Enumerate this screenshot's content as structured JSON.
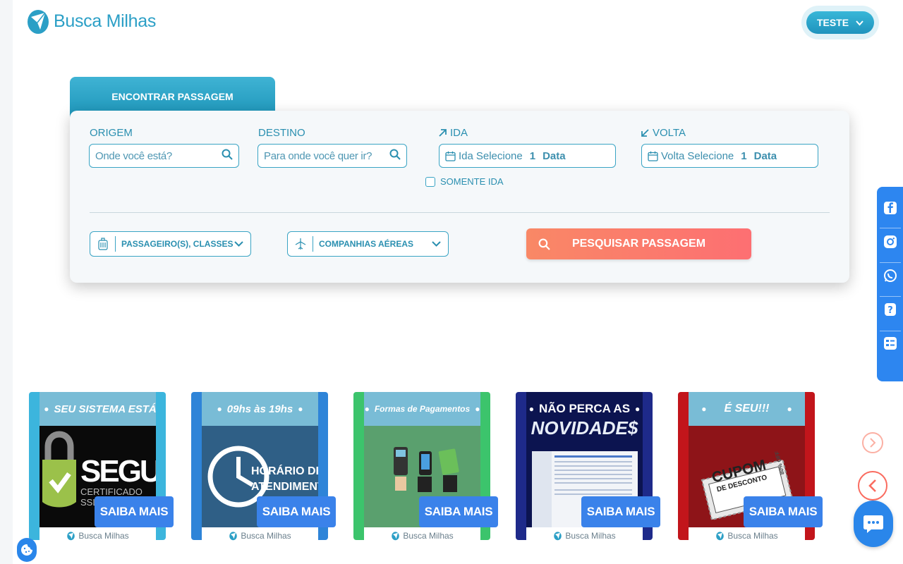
{
  "header": {
    "brand": "Busca Milhas",
    "user_label": "TESTE"
  },
  "search": {
    "tab_label": "ENCONTRAR PASSAGEM",
    "origin": {
      "label": "ORIGEM",
      "placeholder": "Onde você está?"
    },
    "destination": {
      "label": "DESTINO",
      "placeholder": "Para onde você quer ir?"
    },
    "departure": {
      "label": "IDA",
      "prefix": "Ida",
      "select_text": "Selecione",
      "count": "1",
      "data_text": "Data"
    },
    "return": {
      "label": "VOLTA",
      "prefix": "Volta",
      "select_text": "Selecione",
      "count": "1",
      "data_text": "Data"
    },
    "one_way_label": "SOMENTE IDA",
    "passengers_label": "PASSAGEIRO(S), CLASSES",
    "airlines_label": "COMPANHIAS AÉREAS",
    "submit_label": "PESQUISAR PASSAGEM"
  },
  "promos": [
    {
      "banner": "SEU SISTEMA ESTÁ",
      "headline": "SEGURO",
      "sub": "CERTIFICADO SSL",
      "button": "SAIBA MAIS",
      "footer": "Busca Milhas",
      "frame_color": "#3cb5dd",
      "bg": "#0a0a0a"
    },
    {
      "banner": "09hs às 19hs",
      "headline": "HORÁRIO DE",
      "sub": "ATENDIMENTO",
      "button": "SAIBA MAIS",
      "footer": "Busca Milhas",
      "frame_color": "#2e84d8",
      "bg": "#2f5f86"
    },
    {
      "banner": "Formas de Pagamentos",
      "button": "SAIBA MAIS",
      "footer": "Busca Milhas",
      "frame_color": "#3cc46c",
      "bg": "#5aa06e"
    },
    {
      "banner": "NÃO PERCA AS",
      "headline": "NOVIDADE$",
      "button": "SAIBA MAIS",
      "footer": "Busca Milhas",
      "frame_color": "#1e2a8a",
      "bg": "#0c1450"
    },
    {
      "banner": "É SEU!!!",
      "headline": "CUPOM",
      "sub": "DE DESCONTO",
      "side": "80% OFF",
      "button": "SAIBA MAIS",
      "footer": "Busca Milhas",
      "frame_color": "#c2151b",
      "bg": "#8e1418"
    }
  ],
  "social_icons": [
    "facebook-icon",
    "instagram-icon",
    "whatsapp-icon",
    "help-icon",
    "contact-card-icon"
  ]
}
